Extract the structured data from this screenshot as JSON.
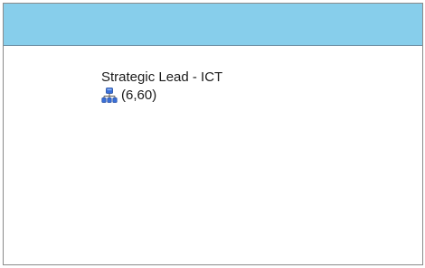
{
  "node": {
    "title": "Strategic Lead - ICT",
    "icon": "org-chart-icon",
    "count": "(6,60)"
  }
}
